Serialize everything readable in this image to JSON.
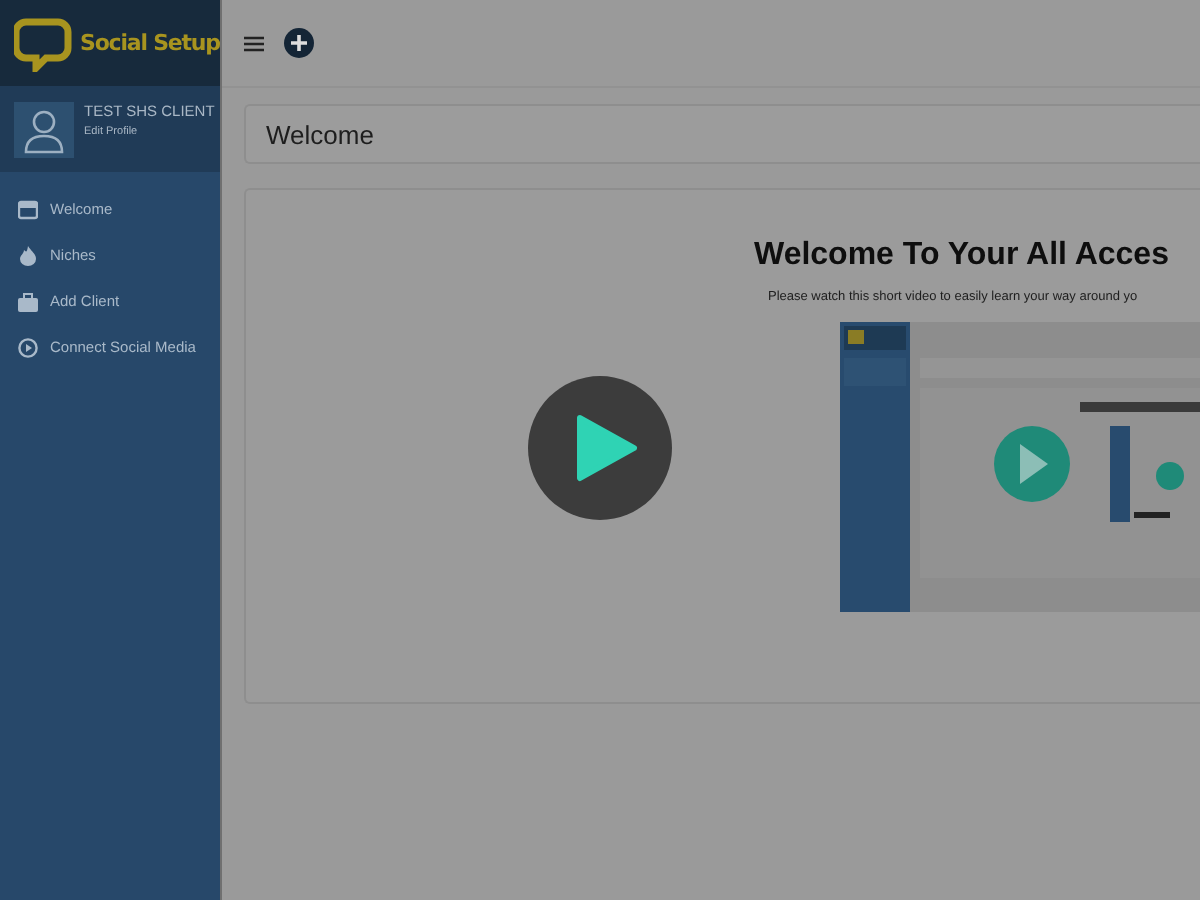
{
  "sidebar": {
    "logo": "Social Setup",
    "user": {
      "name": "TEST SHS CLIENT",
      "link": "Edit Profile"
    },
    "items": [
      {
        "label": "Welcome"
      },
      {
        "label": "Niches"
      },
      {
        "label": "Add Client"
      },
      {
        "label": "Connect Social Media"
      }
    ]
  },
  "page_title": "Welcome",
  "video_card": {
    "heading": "Welcome To Your All Acces",
    "subtitle": "Please watch this short video to easily learn your way around yo"
  }
}
